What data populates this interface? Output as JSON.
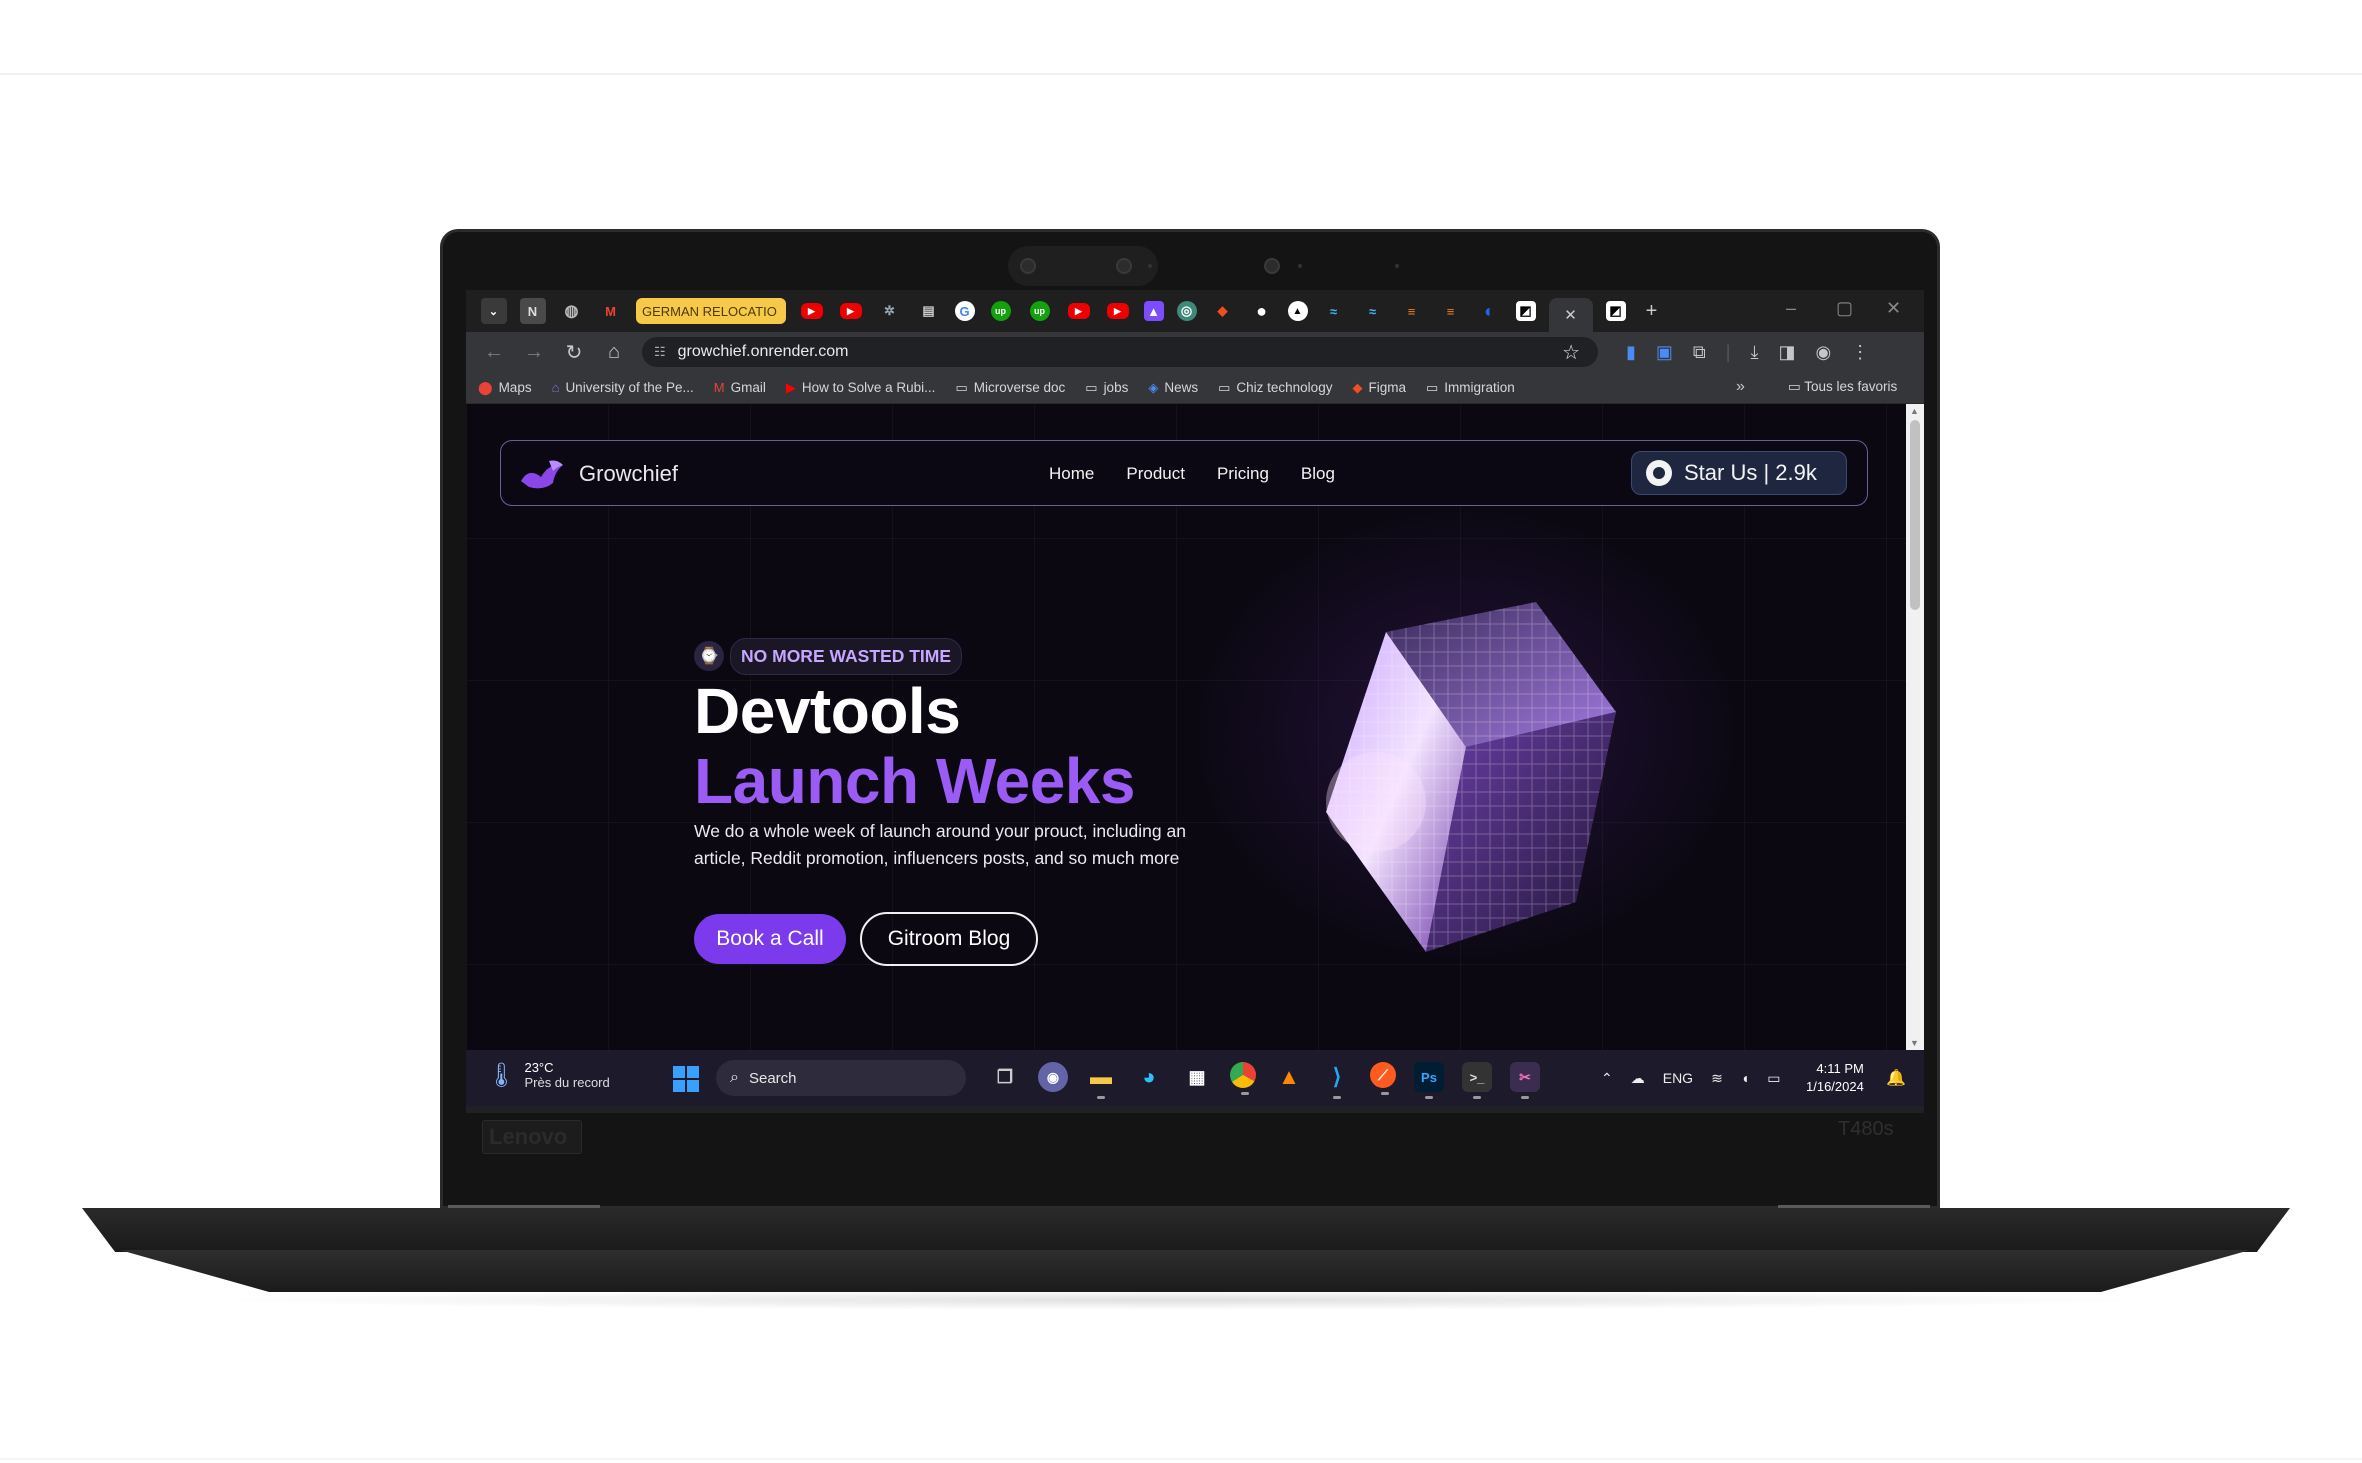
{
  "browser": {
    "tabs": [
      {
        "icon": "tab-search-icon",
        "label": ""
      },
      {
        "icon": "notion-icon",
        "label": "N"
      },
      {
        "icon": "globe-icon",
        "label": ""
      },
      {
        "icon": "gmail-icon",
        "label": "M"
      },
      {
        "icon": "folder-tab",
        "label": "GERMAN RELOCATIO"
      }
    ],
    "url": "growchief.onrender.com",
    "window_controls": [
      "–",
      "▢",
      "✕"
    ],
    "new_tab": "+"
  },
  "bookmarks": {
    "items": [
      {
        "icon": "maps-icon",
        "label": "Maps"
      },
      {
        "icon": "university-icon",
        "label": "University of the Pe..."
      },
      {
        "icon": "gmail-icon",
        "label": "Gmail"
      },
      {
        "icon": "youtube-icon",
        "label": "How to Solve a Rubi..."
      },
      {
        "icon": "folder-icon",
        "label": "Microverse doc"
      },
      {
        "icon": "folder-icon",
        "label": "jobs"
      },
      {
        "icon": "news-icon",
        "label": "News"
      },
      {
        "icon": "folder-icon",
        "label": "Chiz technology"
      },
      {
        "icon": "figma-icon",
        "label": "Figma"
      },
      {
        "icon": "folder-icon",
        "label": "Immigration"
      }
    ],
    "more": "»",
    "all_label": "Tous les favoris"
  },
  "site": {
    "logo_text": "Growchief",
    "nav": [
      "Home",
      "Product",
      "Pricing",
      "Blog"
    ],
    "star_label": "Star Us | 2.9k",
    "badge": "NO MORE WASTED TIME",
    "hero_line1": "Devtools",
    "hero_line2": "Launch Weeks",
    "description": "We do a whole week of launch around your prouct, including an article, Reddit promotion, influencers posts, and so much more",
    "cta_primary": "Book a Call",
    "cta_secondary": "Gitroom Blog"
  },
  "taskbar": {
    "temperature": "23°C",
    "weather_text": "Près du record",
    "search_placeholder": "Search",
    "language": "ENG",
    "time": "4:11 PM",
    "date": "1/16/2024"
  },
  "laptop": {
    "brand": "Lenovo",
    "model": "T480s"
  },
  "colors": {
    "accent": "#7c3aed",
    "hero_purple": "#9b5cf6",
    "badge_text": "#c7a6ff",
    "page_bg": "#0b0812"
  }
}
